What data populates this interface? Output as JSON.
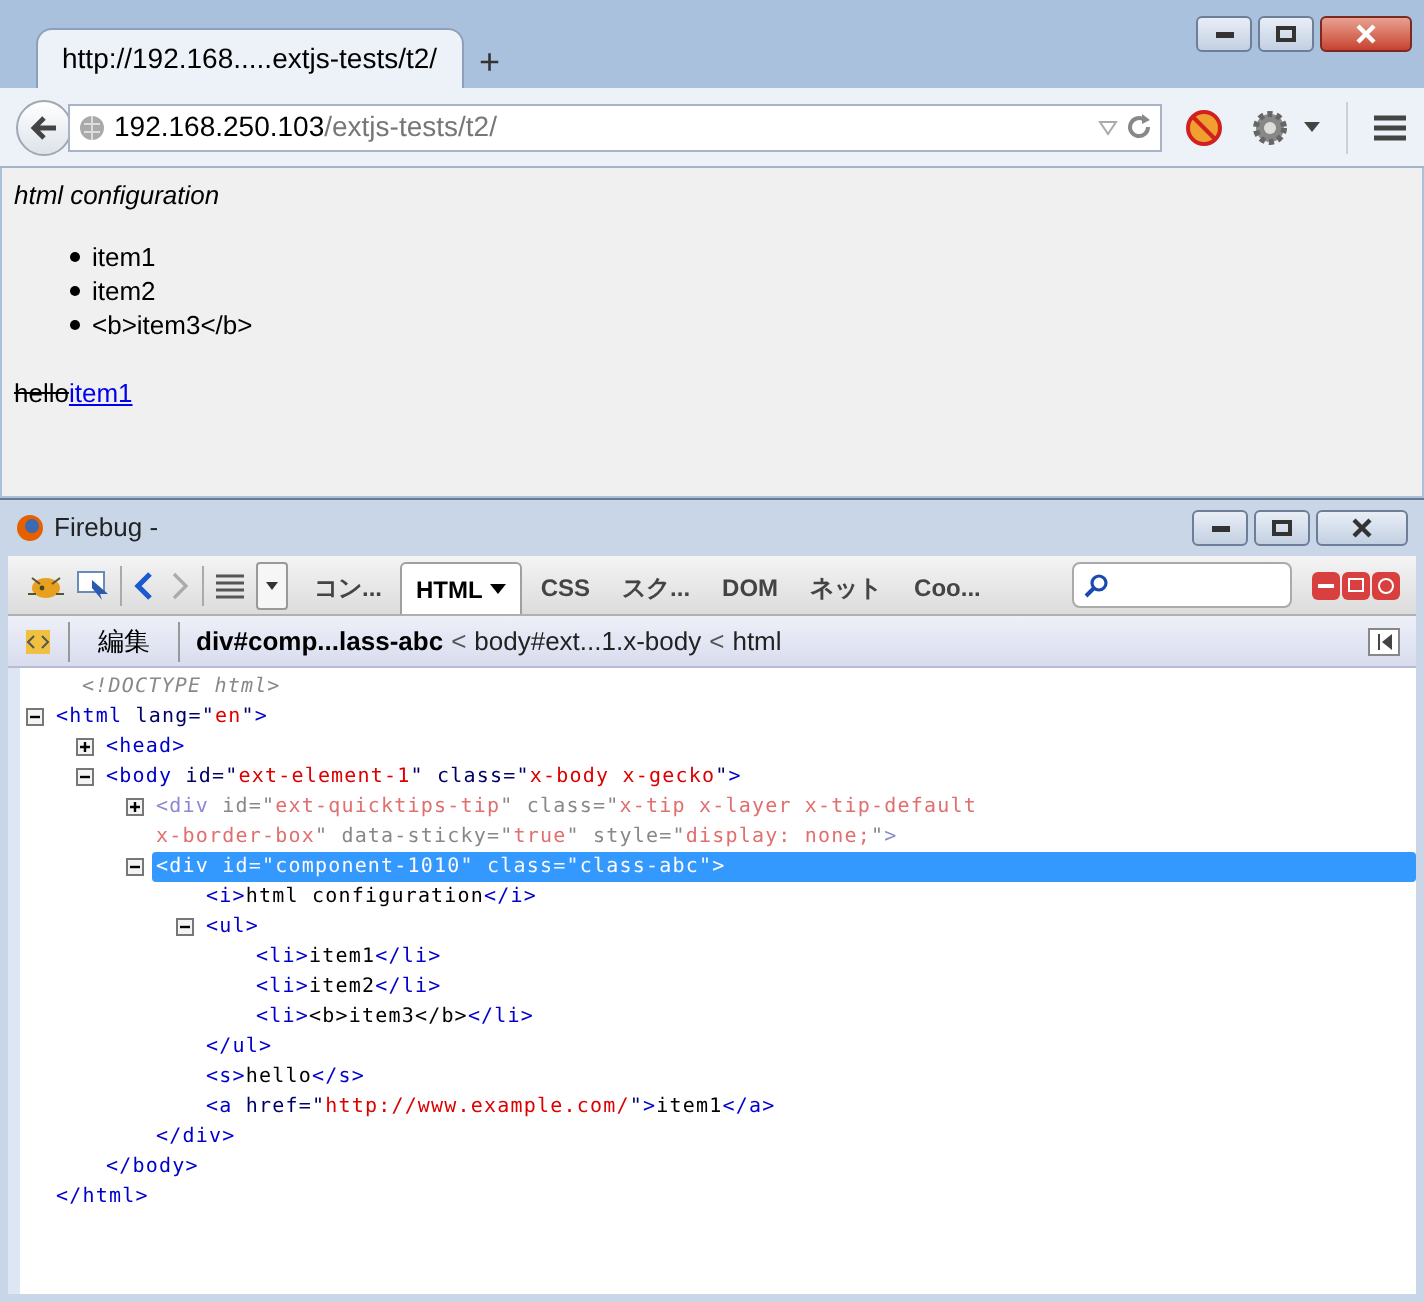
{
  "browser": {
    "tab": {
      "title": "http://192.168.....extjs-tests/t2/"
    },
    "new_tab": "+",
    "url": {
      "host": "192.168.250.103",
      "path": "/extjs-tests/t2/"
    },
    "page": {
      "heading": "html configuration",
      "items": [
        "item1",
        "item2",
        "<b>item3</b>"
      ],
      "struck": "hello",
      "link": "item1"
    }
  },
  "firebug": {
    "title": "Firebug -",
    "tabs": [
      {
        "label": "コン...",
        "selected": false
      },
      {
        "label": "HTML",
        "selected": true,
        "menu": true
      },
      {
        "label": "CSS",
        "selected": false
      },
      {
        "label": "スク...",
        "selected": false
      },
      {
        "label": "DOM",
        "selected": false
      },
      {
        "label": "ネット",
        "selected": false
      },
      {
        "label": "Coo...",
        "selected": false
      }
    ],
    "edit": "編集",
    "breadcrumbs": [
      {
        "label": "div#comp...lass-abc",
        "selected": true
      },
      {
        "label": "body#ext...1.x-body",
        "selected": false
      },
      {
        "label": "html",
        "selected": false
      }
    ],
    "separator": "<",
    "tree": [
      {
        "lines": [
          [
            {
              "kind": "doctype",
              "text": "<!DOCTYPE html>"
            }
          ]
        ]
      },
      {
        "expanded": true,
        "lines": [
          [
            {
              "kind": "tag",
              "text": "<html"
            },
            {
              "kind": "attr",
              "text": " lang=\""
            },
            {
              "kind": "value",
              "text": "en"
            },
            {
              "kind": "attr",
              "text": "\""
            },
            {
              "kind": "tag",
              "text": ">"
            }
          ]
        ],
        "close": [
          {
            "kind": "tag",
            "text": "</html>"
          }
        ],
        "children": [
          {
            "expanded": false,
            "lines": [
              [
                {
                  "kind": "tag",
                  "text": "<head>"
                }
              ]
            ]
          },
          {
            "expanded": true,
            "lines": [
              [
                {
                  "kind": "tag",
                  "text": "<body"
                },
                {
                  "kind": "attr",
                  "text": " id=\""
                },
                {
                  "kind": "value",
                  "text": "ext-element-1"
                },
                {
                  "kind": "attr",
                  "text": "\" class=\""
                },
                {
                  "kind": "value",
                  "text": "x-body x-gecko"
                },
                {
                  "kind": "attr",
                  "text": "\""
                },
                {
                  "kind": "tag",
                  "text": ">"
                }
              ]
            ],
            "close": [
              {
                "kind": "tag",
                "text": "</body>"
              }
            ],
            "children": [
              {
                "expanded": false,
                "hidden": true,
                "selected": false,
                "lines": [
                  [
                    {
                      "kind": "tag",
                      "text": "<div"
                    },
                    {
                      "kind": "attr",
                      "text": " id=\""
                    },
                    {
                      "kind": "value",
                      "text": "ext-quicktips-tip"
                    },
                    {
                      "kind": "attr",
                      "text": "\" class=\""
                    },
                    {
                      "kind": "value",
                      "text": "x-tip x-layer x-tip-default"
                    }
                  ],
                  [
                    {
                      "kind": "value",
                      "text": "x-border-box"
                    },
                    {
                      "kind": "attr",
                      "text": "\" data-sticky=\""
                    },
                    {
                      "kind": "value",
                      "text": "true"
                    },
                    {
                      "kind": "attr",
                      "text": "\" style=\""
                    },
                    {
                      "kind": "value",
                      "text": "display: none;"
                    },
                    {
                      "kind": "attr",
                      "text": "\""
                    },
                    {
                      "kind": "tag",
                      "text": ">"
                    }
                  ]
                ]
              },
              {
                "expanded": true,
                "hidden": false,
                "selected": true,
                "lines": [
                  [
                    {
                      "kind": "tag",
                      "text": "<div"
                    },
                    {
                      "kind": "attr",
                      "text": " id=\""
                    },
                    {
                      "kind": "value",
                      "text": "component-1010"
                    },
                    {
                      "kind": "attr",
                      "text": "\" class=\""
                    },
                    {
                      "kind": "value",
                      "text": "class-abc"
                    },
                    {
                      "kind": "attr",
                      "text": "\""
                    },
                    {
                      "kind": "tag",
                      "text": ">"
                    }
                  ]
                ],
                "close": [
                  {
                    "kind": "tag",
                    "text": "</div>"
                  }
                ],
                "children": [
                  {
                    "lines": [
                      [
                        {
                          "kind": "tag",
                          "text": "<i>"
                        },
                        {
                          "kind": "text",
                          "text": "html configuration"
                        },
                        {
                          "kind": "tag",
                          "text": "</i>"
                        }
                      ]
                    ]
                  },
                  {
                    "expanded": true,
                    "lines": [
                      [
                        {
                          "kind": "tag",
                          "text": "<ul>"
                        }
                      ]
                    ],
                    "close": [
                      {
                        "kind": "tag",
                        "text": "</ul>"
                      }
                    ],
                    "children": [
                      {
                        "lines": [
                          [
                            {
                              "kind": "tag",
                              "text": "<li>"
                            },
                            {
                              "kind": "text",
                              "text": "item1"
                            },
                            {
                              "kind": "tag",
                              "text": "</li>"
                            }
                          ]
                        ]
                      },
                      {
                        "lines": [
                          [
                            {
                              "kind": "tag",
                              "text": "<li>"
                            },
                            {
                              "kind": "text",
                              "text": "item2"
                            },
                            {
                              "kind": "tag",
                              "text": "</li>"
                            }
                          ]
                        ]
                      },
                      {
                        "lines": [
                          [
                            {
                              "kind": "tag",
                              "text": "<li>"
                            },
                            {
                              "kind": "text",
                              "text": "<b>item3</b>"
                            },
                            {
                              "kind": "tag",
                              "text": "</li>"
                            }
                          ]
                        ]
                      }
                    ]
                  },
                  {
                    "lines": [
                      [
                        {
                          "kind": "tag",
                          "text": "<s>"
                        },
                        {
                          "kind": "text",
                          "text": "hello"
                        },
                        {
                          "kind": "tag",
                          "text": "</s>"
                        }
                      ]
                    ]
                  },
                  {
                    "lines": [
                      [
                        {
                          "kind": "tag",
                          "text": "<a"
                        },
                        {
                          "kind": "attr",
                          "text": " href=\""
                        },
                        {
                          "kind": "value",
                          "text": "http://www.example.com/"
                        },
                        {
                          "kind": "attr",
                          "text": "\""
                        },
                        {
                          "kind": "tag",
                          "text": ">"
                        },
                        {
                          "kind": "text",
                          "text": "item1"
                        },
                        {
                          "kind": "tag",
                          "text": "</a>"
                        }
                      ]
                    ]
                  }
                ]
              }
            ]
          }
        ]
      }
    ]
  }
}
